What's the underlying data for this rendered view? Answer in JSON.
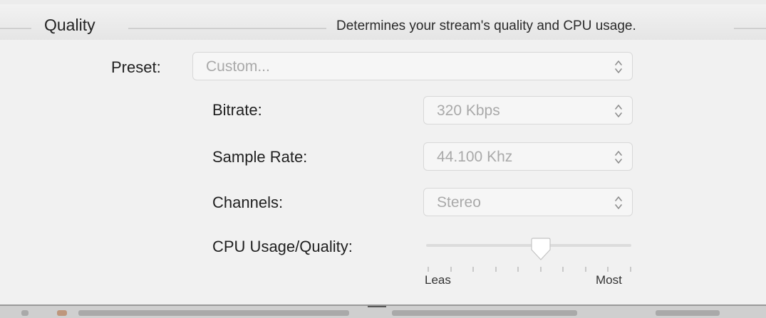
{
  "group": {
    "title": "Quality",
    "description": "Determines your stream's quality and CPU usage."
  },
  "preset": {
    "label": "Preset:",
    "value": "Custom..."
  },
  "bitrate": {
    "label": "Bitrate:",
    "value": "320 Kbps"
  },
  "sample_rate": {
    "label": "Sample Rate:",
    "value": "44.100 Khz"
  },
  "channels": {
    "label": "Channels:",
    "value": "Stereo"
  },
  "cpu_quality": {
    "label": "CPU Usage/Quality:",
    "min_label": "Leas",
    "max_label": "Most",
    "tick_count": 10,
    "value_fraction": 0.56
  },
  "icons": {
    "select_stepper": "chevron-up-down-icon",
    "slider_thumb": "slider-thumb-icon"
  },
  "colors": {
    "disabled_text": "#a9a9a9",
    "label_text": "#1f1f1f"
  }
}
